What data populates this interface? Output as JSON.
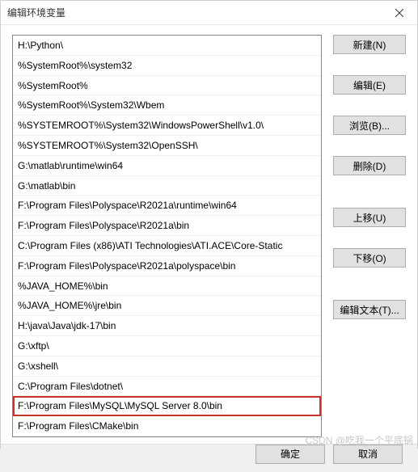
{
  "window": {
    "title": "编辑环境变量"
  },
  "list": {
    "items": [
      {
        "text": "H:\\Python\\",
        "highlighted": false
      },
      {
        "text": "%SystemRoot%\\system32",
        "highlighted": false
      },
      {
        "text": "%SystemRoot%",
        "highlighted": false
      },
      {
        "text": "%SystemRoot%\\System32\\Wbem",
        "highlighted": false
      },
      {
        "text": "%SYSTEMROOT%\\System32\\WindowsPowerShell\\v1.0\\",
        "highlighted": false
      },
      {
        "text": "%SYSTEMROOT%\\System32\\OpenSSH\\",
        "highlighted": false
      },
      {
        "text": "G:\\matlab\\runtime\\win64",
        "highlighted": false
      },
      {
        "text": "G:\\matlab\\bin",
        "highlighted": false
      },
      {
        "text": "F:\\Program Files\\Polyspace\\R2021a\\runtime\\win64",
        "highlighted": false
      },
      {
        "text": "F:\\Program Files\\Polyspace\\R2021a\\bin",
        "highlighted": false
      },
      {
        "text": "C:\\Program Files (x86)\\ATI Technologies\\ATI.ACE\\Core-Static",
        "highlighted": false
      },
      {
        "text": "F:\\Program Files\\Polyspace\\R2021a\\polyspace\\bin",
        "highlighted": false
      },
      {
        "text": "%JAVA_HOME%\\bin",
        "highlighted": false
      },
      {
        "text": "%JAVA_HOME%\\jre\\bin",
        "highlighted": false
      },
      {
        "text": "H:\\java\\Java\\jdk-17\\bin",
        "highlighted": false
      },
      {
        "text": "G:\\xftp\\",
        "highlighted": false
      },
      {
        "text": "G:\\xshell\\",
        "highlighted": false
      },
      {
        "text": "C:\\Program Files\\dotnet\\",
        "highlighted": false
      },
      {
        "text": "F:\\Program Files\\MySQL\\MySQL Server 8.0\\bin",
        "highlighted": true
      },
      {
        "text": "F:\\Program Files\\CMake\\bin",
        "highlighted": false
      }
    ]
  },
  "buttons": {
    "new": "新建(N)",
    "edit": "编辑(E)",
    "browse": "浏览(B)...",
    "delete": "删除(D)",
    "moveUp": "上移(U)",
    "moveDown": "下移(O)",
    "editText": "编辑文本(T)..."
  },
  "footer": {
    "ok": "确定",
    "cancel": "取消"
  },
  "watermark": "CSDN @吃我一个平底锅"
}
